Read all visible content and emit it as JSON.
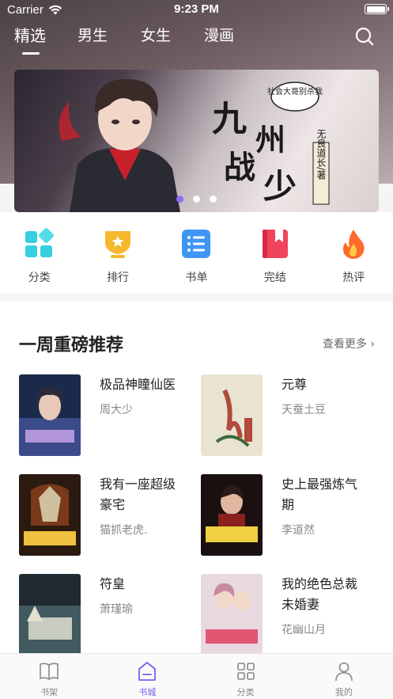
{
  "status_bar": {
    "carrier": "Carrier",
    "time": "9:23 PM"
  },
  "top_tabs": [
    {
      "label": "精选",
      "active": true
    },
    {
      "label": "男生",
      "active": false
    },
    {
      "label": "女生",
      "active": false
    },
    {
      "label": "漫画",
      "active": false
    }
  ],
  "banner": {
    "title_big": "九州",
    "title_big2": "战少",
    "bubble": "社会大哥别杀我",
    "author_tag": "无良道长/著",
    "dots": 3,
    "active_dot": 0
  },
  "quick_menu": [
    {
      "label": "分类",
      "icon": "category-grid-icon",
      "color": "#35cfe0"
    },
    {
      "label": "排行",
      "icon": "trophy-icon",
      "color": "#f5b72c"
    },
    {
      "label": "书单",
      "icon": "list-icon",
      "color": "#3f96f5"
    },
    {
      "label": "完结",
      "icon": "bookmark-book-icon",
      "color": "#f0445d"
    },
    {
      "label": "热评",
      "icon": "flame-icon",
      "color": "#ff6b2b"
    }
  ],
  "recommend": {
    "title": "一周重磅推荐",
    "more": "查看更多",
    "books": [
      {
        "title": "极品神瞳仙医",
        "author": "周大少",
        "cover_colors": [
          "#1b2a4a",
          "#3b4b8a",
          "#c8a2e8"
        ]
      },
      {
        "title": "元尊",
        "author": "天蚕土豆",
        "cover_colors": [
          "#e9e3d2",
          "#b04a3a",
          "#3a6b3a"
        ]
      },
      {
        "title": "我有一座超级豪宅",
        "author": "猫抓老虎.",
        "cover_colors": [
          "#2a1a10",
          "#7a3a1a",
          "#f0c040"
        ]
      },
      {
        "title": "史上最强炼气期",
        "author": "李道然",
        "cover_colors": [
          "#1a1010",
          "#8a2020",
          "#f0d040"
        ]
      },
      {
        "title": "符皇",
        "author": "萧瑾瑜",
        "cover_colors": [
          "#202a30",
          "#405a60",
          "#e0e0d0"
        ]
      },
      {
        "title": "我的绝色总裁未婚妻",
        "author": "花幽山月",
        "cover_colors": [
          "#e8d8e0",
          "#c88aa0",
          "#e04060"
        ]
      }
    ]
  },
  "tab_bar": [
    {
      "label": "书架",
      "icon": "book-open-icon",
      "active": false
    },
    {
      "label": "书城",
      "icon": "store-icon",
      "active": true
    },
    {
      "label": "分类",
      "icon": "grid-icon",
      "active": false
    },
    {
      "label": "我的",
      "icon": "person-icon",
      "active": false
    }
  ],
  "colors": {
    "accent": "#7c5cf0",
    "text": "#222222",
    "muted": "#888888"
  }
}
